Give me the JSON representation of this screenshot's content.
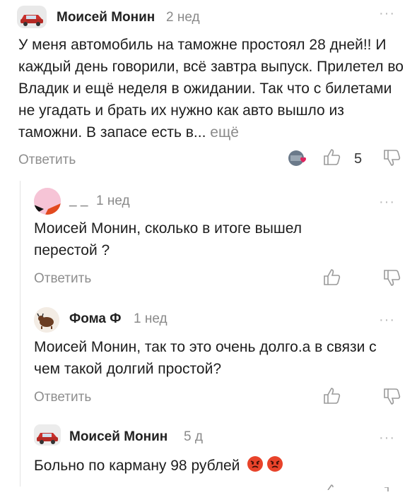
{
  "comments": [
    {
      "author": "Моисей Монин",
      "time": "2 нед",
      "text": "У меня автомобиль на таможне простоял 28 дней!! И каждый день говорили, всё завтра выпуск. Прилетел во Владик и ещё неделя в ожидании. Так что с билетами не угадать и брать их нужно как авто вышло из таможни. В запасе есть в...",
      "more": "ещё",
      "reply_label": "Ответить",
      "likes": "5"
    },
    {
      "author": "_ _",
      "time": "1 нед",
      "text": "Моисей Монин, сколько в итоге вышел перестой ?",
      "reply_label": "Ответить"
    },
    {
      "author": "Фома Ф",
      "time": "1 нед",
      "text": "Моисей Монин, так то это очень долго.а в связи с чем такой долгий простой?",
      "reply_label": "Ответить"
    },
    {
      "author": "Моисей Монин",
      "time": "5 д",
      "text": "Больно по карману 98 рублей",
      "emoji": "angry-face"
    }
  ],
  "icons": {
    "like": "thumbs-up-icon",
    "dislike": "thumbs-down-icon",
    "menu": "more-dots-icon"
  },
  "colors": {
    "secondary_text": "#8a8a8a",
    "accent_heart": "#e0245e"
  }
}
